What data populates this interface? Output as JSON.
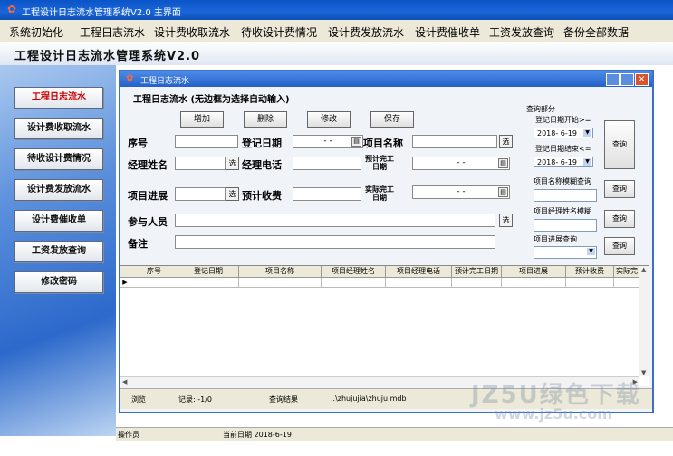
{
  "window": {
    "title": "工程设计日志流水管理系统V2.0 主界面"
  },
  "menu": [
    "系统初始化",
    "工程日志流水",
    "设计费收取流水",
    "待收设计费情况",
    "设计费发放流水",
    "设计费催收单",
    "工资发放查询",
    "备份全部数据"
  ],
  "sub_header": "工程设计日志流水管理系统V2.0",
  "sidebar": [
    {
      "label": "工程日志流水"
    },
    {
      "label": "设计费收取流水"
    },
    {
      "label": "待收设计费情况"
    },
    {
      "label": "设计费发放流水"
    },
    {
      "label": "设计费催收单"
    },
    {
      "label": "工资发放查询"
    },
    {
      "label": "修改密码"
    }
  ],
  "child": {
    "title": "工程日志流水",
    "caption": "工程日志流水 (无边框为选择自动输入)",
    "buttons": {
      "add": "增加",
      "delete": "删除",
      "modify": "修改",
      "save": "保存"
    },
    "labels": {
      "seq": "序号",
      "reg_date": "登记日期",
      "project_name": "项目名称",
      "manager_name": "经理姓名",
      "manager_phone": "经理电话",
      "planned_finish_a": "预计完工",
      "planned_finish_b": "日期",
      "progress": "项目进展",
      "expected_fee": "预计收费",
      "actual_finish_a": "实际完工",
      "actual_finish_b": "日期",
      "participants": "参与人员",
      "remark": "备注"
    },
    "pick_label": "选",
    "date_blank": "-   -",
    "query": {
      "title": "查询部分",
      "start_label": "登记日期开始>=",
      "start_value": "2018- 6-19",
      "end_label": "登记日期结束<=",
      "end_value": "2018- 6-19",
      "name_fuzzy": "项目名称模糊查询",
      "manager_fuzzy": "项目经理姓名模糊",
      "progress_query": "项目进展查询",
      "btn": "查询"
    },
    "grid": {
      "columns": [
        "序号",
        "登记日期",
        "项目名称",
        "项目经理姓名",
        "项目经理电话",
        "预计完工日期",
        "项目进展",
        "预计收费",
        "实际完"
      ]
    },
    "status": {
      "browse": "浏览",
      "record": "记录: -1/0",
      "query_result": "查询结果",
      "db_path": "..\\zhujujia\\zhuju.mdb"
    }
  },
  "status_bar": {
    "operator": "操作员",
    "current_date": "当前日期 2018-6-19"
  },
  "watermark": {
    "line1": "JZ5U绿色下载",
    "line2": "www.jz5u.com"
  }
}
